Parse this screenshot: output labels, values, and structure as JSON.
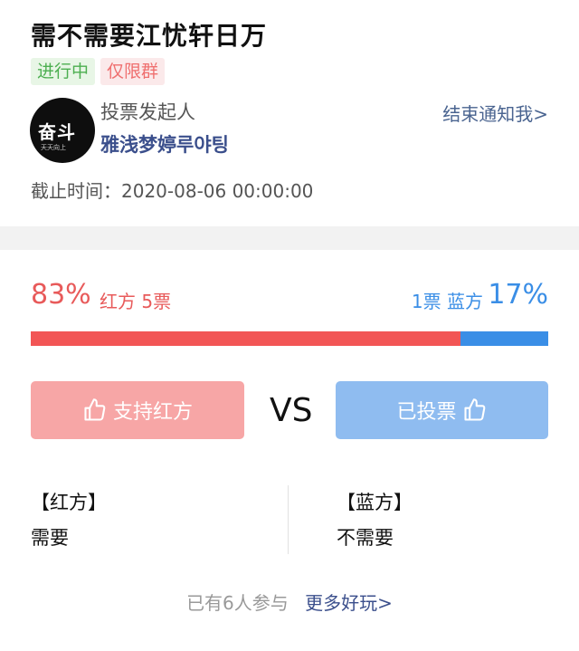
{
  "poll": {
    "title": "需不需要江忧轩日万",
    "status_tag": "进行中",
    "group_tag": "仅限群",
    "initiator_label": "投票发起人",
    "initiator_name": "雅浅梦婷루야팅",
    "notify_link": "结束通知我>",
    "deadline": "截止时间：2020-08-06 00:00:00"
  },
  "avatar": {
    "big_text": "奋斗",
    "small_text": "天天向上"
  },
  "red": {
    "percent": "83%",
    "label": "红方 5票",
    "fraction": 0.83,
    "button": "支持红方",
    "side_title": "【红方】",
    "position": "需要",
    "color": "#f25555"
  },
  "blue": {
    "percent": "17%",
    "label": "1票  蓝方",
    "fraction": 0.17,
    "button": "已投票",
    "side_title": "【蓝方】",
    "position": "不需要",
    "color": "#3a8ee6"
  },
  "vs": "VS",
  "footer": {
    "participants": "已有6人参与",
    "more": "更多好玩>"
  }
}
